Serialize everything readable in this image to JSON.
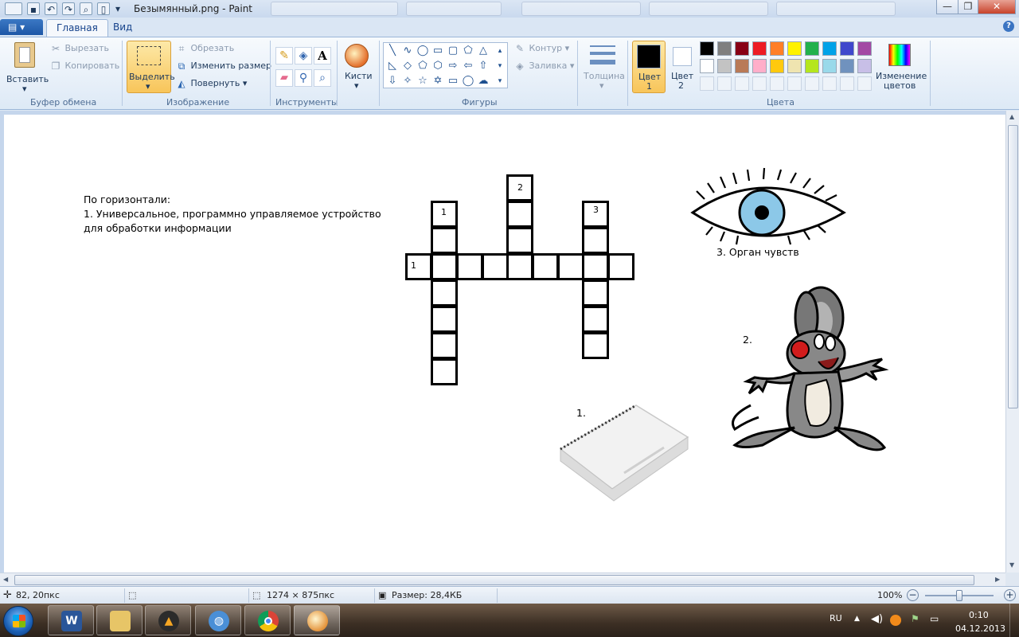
{
  "window": {
    "title": "Безымянный.png - Paint",
    "controls": {
      "minimize": "—",
      "maximize": "❐",
      "close": "✕"
    }
  },
  "ribbon_tabs": [
    {
      "label": "Главная",
      "active": true
    },
    {
      "label": "Вид",
      "active": false
    }
  ],
  "app_menu": {
    "label": "▾"
  },
  "help": {
    "label": "?"
  },
  "clipboard": {
    "paste": "Вставить",
    "cut": "Вырезать",
    "copy": "Копировать",
    "group": "Буфер обмена"
  },
  "image": {
    "select": "Выделить",
    "crop": "Обрезать",
    "resize": "Изменить размер",
    "rotate": "Повернуть",
    "group": "Изображение"
  },
  "tools": {
    "group": "Инструменты",
    "text_icon": "A"
  },
  "brushes": {
    "label": "Кисти"
  },
  "shapes": {
    "outline": "Контур",
    "fill": "Заливка",
    "group": "Фигуры"
  },
  "size": {
    "label": "Толщина"
  },
  "colors": {
    "color1_label_a": "Цвет",
    "color1_label_b": "1",
    "color2_label_a": "Цвет",
    "color2_label_b": "2",
    "edit_a": "Изменение",
    "edit_b": "цветов",
    "group": "Цвета",
    "color1": "#000000",
    "color2": "#ffffff",
    "palette_row1": [
      "#000000",
      "#7f7f7f",
      "#880015",
      "#ed1c24",
      "#ff7f27",
      "#fff200",
      "#22b14c",
      "#00a2e8",
      "#3f48cc",
      "#a349a4"
    ],
    "palette_row2": [
      "#ffffff",
      "#c3c3c3",
      "#b97a57",
      "#ffaec9",
      "#ffc90e",
      "#efe4b0",
      "#b5e61d",
      "#99d9ea",
      "#7092be",
      "#c8bfe7"
    ]
  },
  "canvas": {
    "clue_heading": "По горизонтали:",
    "clue_line1": "1. Универсальное, программно управляемое устройство",
    "clue_line2": "для обработки информации",
    "crossword_numbers": {
      "n1_top": "1",
      "n2_top": "2",
      "n3_top": "3",
      "n1_left": "1"
    },
    "eye_caption": "3. Орган чувств",
    "mouse_caption": "2.",
    "notebook_caption": "1."
  },
  "statusbar": {
    "cursor_pos": "82, 20пкс",
    "image_size": "1274 × 875пкс",
    "file_size": "Размер: 28,4КБ",
    "zoom": "100%",
    "zoom_level_percent": 100
  },
  "taskbar": {
    "word_icon": "W",
    "language": "RU",
    "time": "0:10",
    "date": "04.12.2013"
  }
}
